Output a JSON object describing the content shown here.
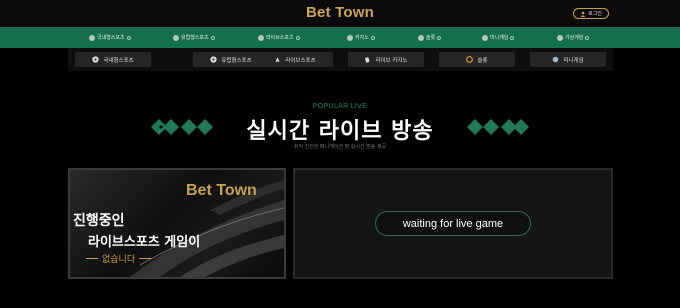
{
  "header": {
    "logo": "Bet Town",
    "login_label": "로그인"
  },
  "nav": {
    "items": [
      {
        "label": "국내형스포츠"
      },
      {
        "label": "유럽형스포츠"
      },
      {
        "label": "라이브스포츠"
      },
      {
        "label": "카지노"
      },
      {
        "label": "슬롯"
      },
      {
        "label": "미니게임"
      },
      {
        "label": "가상게임"
      }
    ]
  },
  "subtabs": [
    {
      "label": "국내형스포츠"
    },
    {
      "label": "유럽형스포츠"
    },
    {
      "label": "라이브스포츠"
    },
    {
      "label": "라이브 카지노"
    },
    {
      "label": "슬롯"
    },
    {
      "label": "미니게임"
    }
  ],
  "section": {
    "subtitle": "POPULAR LIVE",
    "title": "실시간 라이브 방송",
    "description": "쉬익 진진한 매니게이션 및 실시간 방송 제공"
  },
  "banner": {
    "logo": "Bet Town",
    "line1": "진행중인",
    "line2": "라이브스포츠 게임이",
    "line3": "없습니다"
  },
  "live": {
    "status": "waiting for live game"
  },
  "colors": {
    "accent_gold": "#c9a14f",
    "nav_green": "#146f4c",
    "diamond_green": "#1f7a55"
  }
}
